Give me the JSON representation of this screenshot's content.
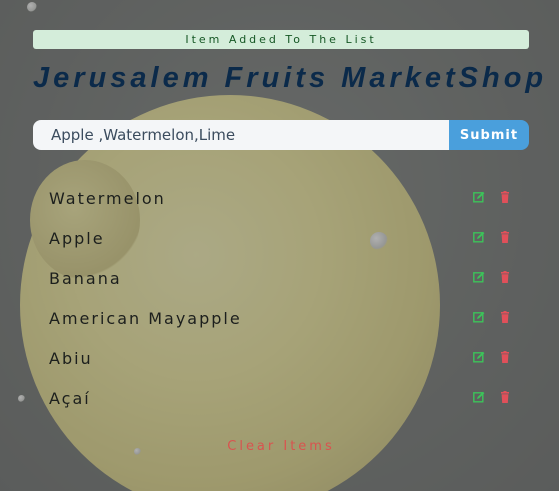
{
  "alert": {
    "text": "Item Added To The List"
  },
  "header": {
    "title": "Jerusalem Fruits MarketShop"
  },
  "form": {
    "input_value": "Apple ,Watermelon,Lime",
    "submit_label": "Submit"
  },
  "items": [
    {
      "name": "Watermelon"
    },
    {
      "name": "Apple"
    },
    {
      "name": "Banana"
    },
    {
      "name": "American Mayapple"
    },
    {
      "name": "Abiu"
    },
    {
      "name": "Açaí"
    }
  ],
  "actions": {
    "clear_label": "Clear Items"
  },
  "icons": {
    "edit": "edit-icon",
    "delete": "trash-icon"
  },
  "colors": {
    "edit": "#3cc35a",
    "delete": "#e0505a",
    "accent": "#4a9fdc"
  }
}
